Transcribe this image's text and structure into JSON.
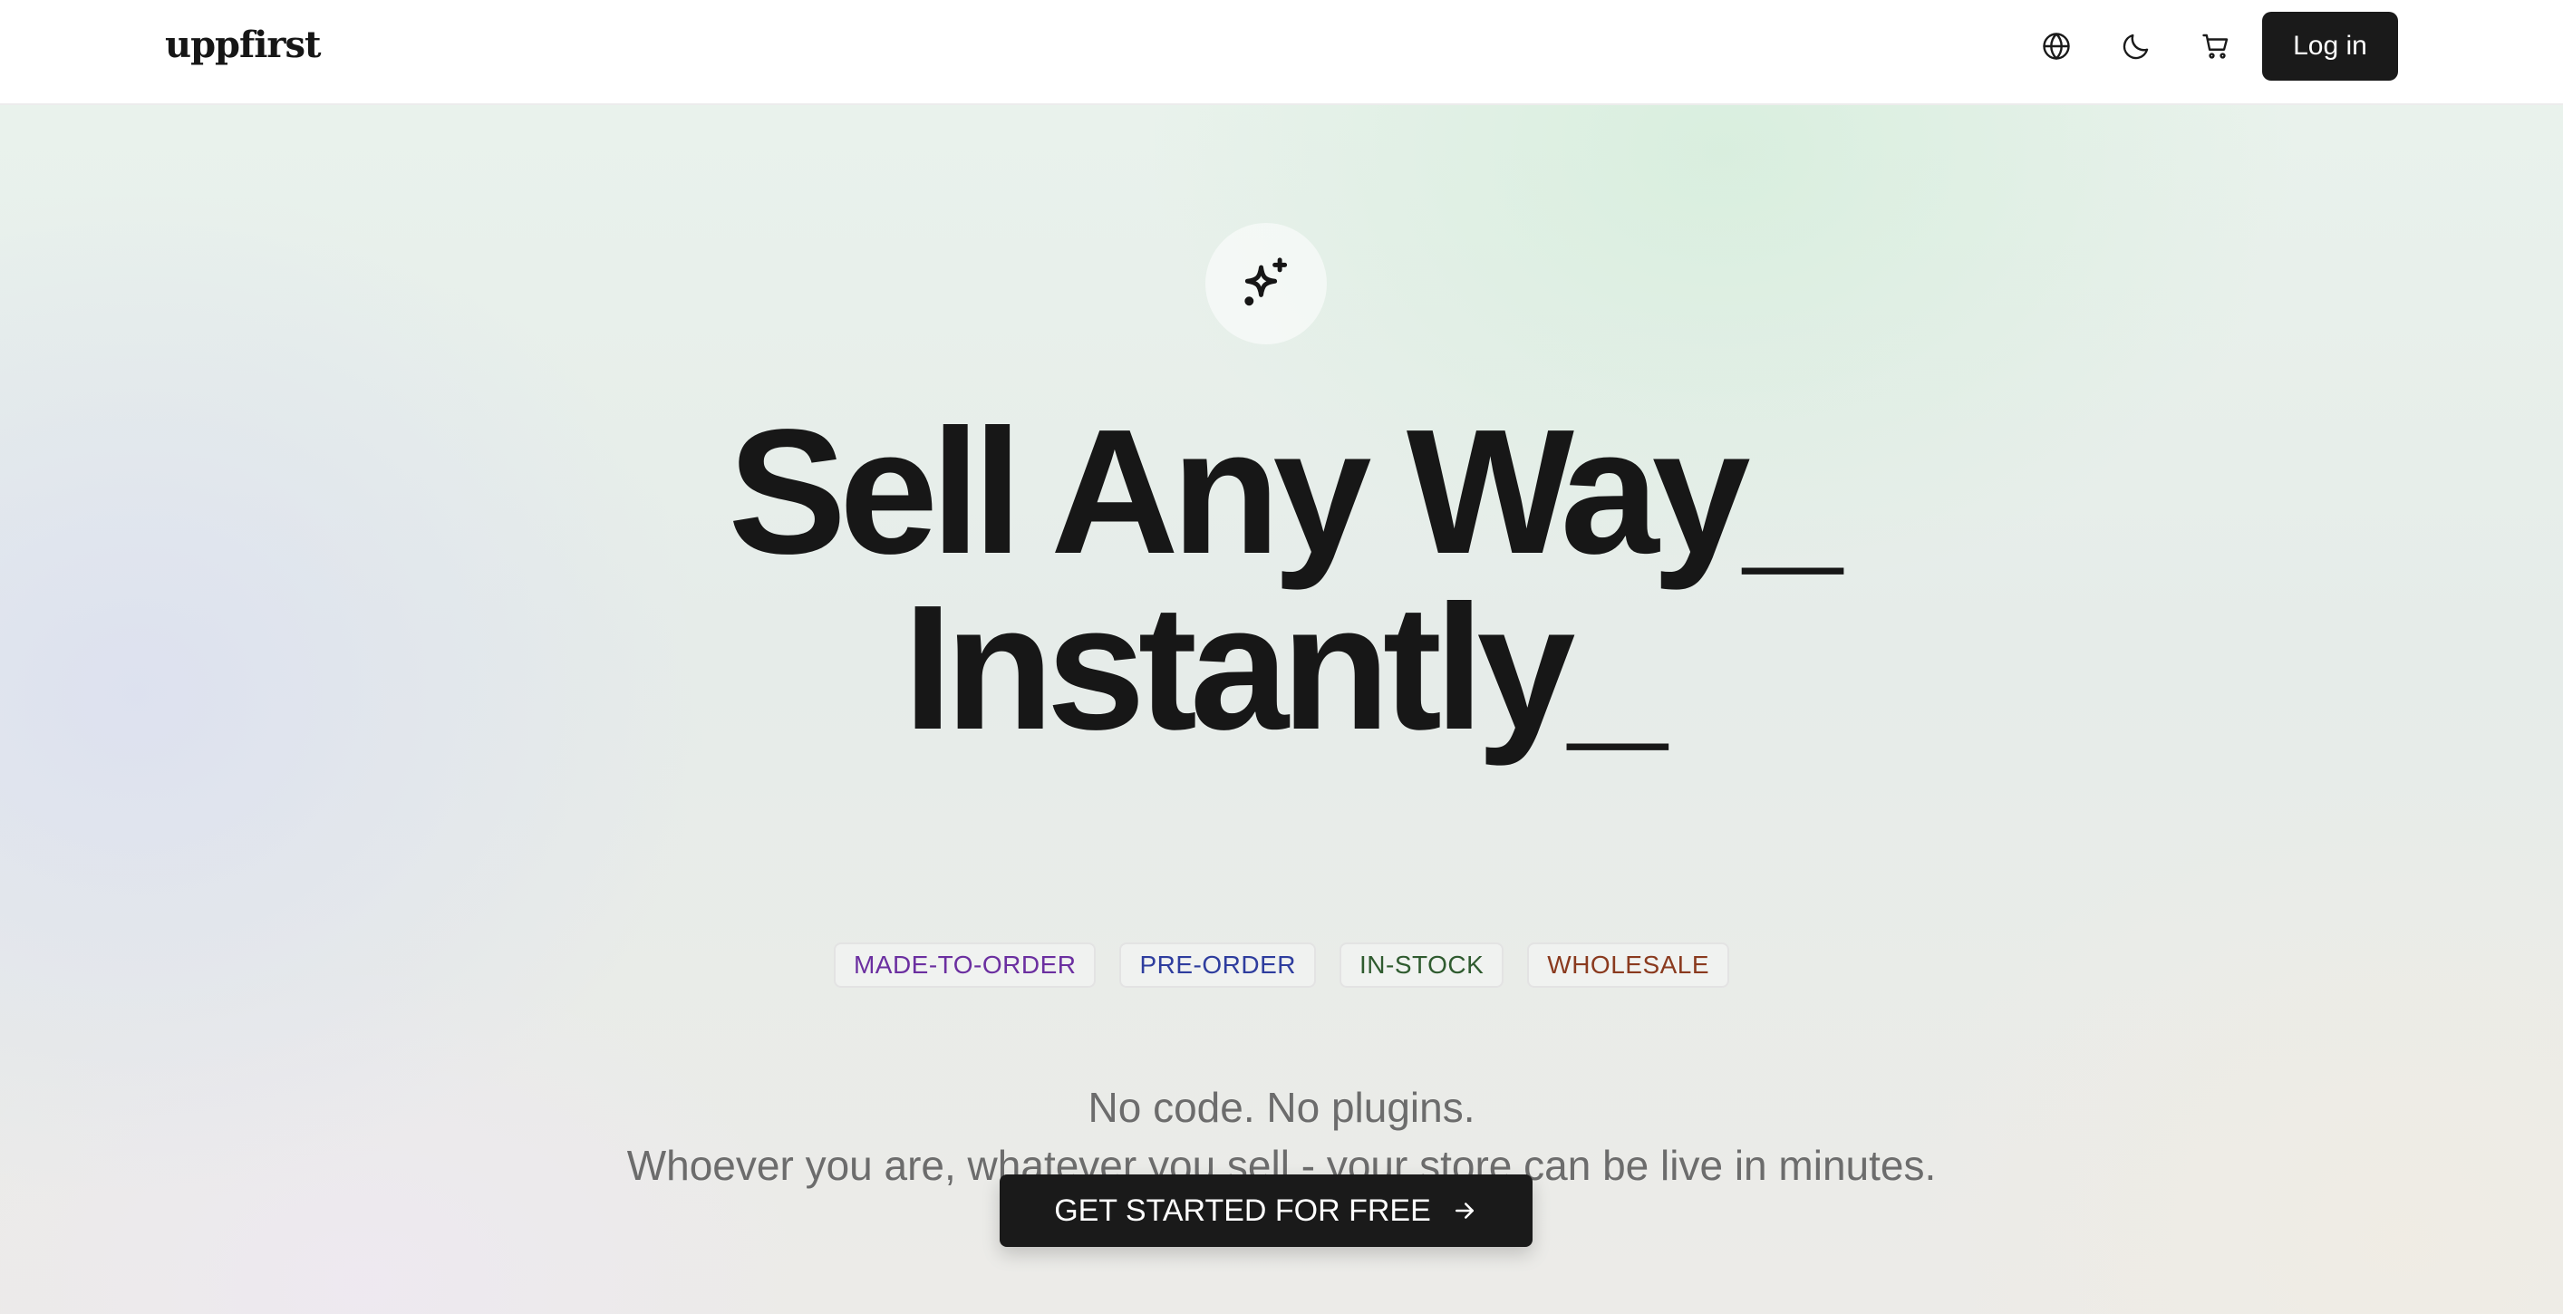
{
  "header": {
    "logo_text": "uppfirst",
    "icons": [
      "globe-icon",
      "moon-icon",
      "cart-icon"
    ],
    "login_label": "Log in"
  },
  "hero": {
    "icon": "sparkles-icon",
    "headline_line1": "Sell Any Way_",
    "headline_line2": "Instantly_",
    "tags": [
      {
        "label": "MADE-TO-ORDER",
        "color": "#6b2fa0"
      },
      {
        "label": "PRE-ORDER",
        "color": "#2e3d9e"
      },
      {
        "label": "IN-STOCK",
        "color": "#2f5b2f"
      },
      {
        "label": "WHOLESALE",
        "color": "#8a3a1e"
      }
    ],
    "subtext_line1": "No code. No plugins.",
    "subtext_line2": "Whoever you are, whatever you sell - your store can be live in minutes.",
    "cta_label": "GET STARTED FOR FREE",
    "cta_icon": "arrow-right-icon"
  },
  "colors": {
    "primary_dark": "#1a1a1a",
    "subtext": "#6c6c6c"
  }
}
